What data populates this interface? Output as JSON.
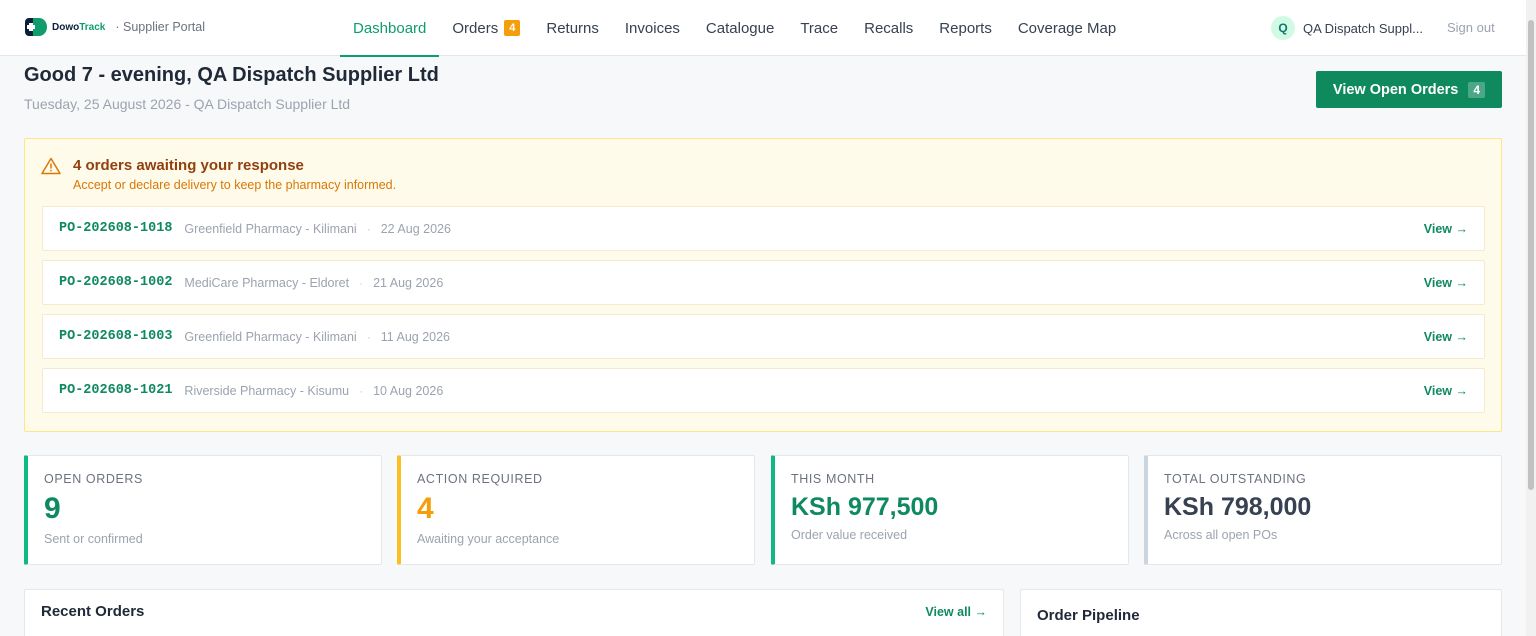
{
  "brand": {
    "name_a": "Dowo",
    "name_b": "Track",
    "portal": "· Supplier Portal"
  },
  "nav": {
    "items": [
      {
        "label": "Dashboard"
      },
      {
        "label": "Orders",
        "badge": "4"
      },
      {
        "label": "Returns"
      },
      {
        "label": "Invoices"
      },
      {
        "label": "Catalogue"
      },
      {
        "label": "Trace"
      },
      {
        "label": "Recalls"
      },
      {
        "label": "Reports"
      },
      {
        "label": "Coverage Map"
      }
    ],
    "active": "Dashboard"
  },
  "user": {
    "initial": "Q",
    "name": "QA Dispatch Suppl...",
    "signout": "Sign out"
  },
  "header": {
    "greeting": "Good 7 - evening, QA Dispatch Supplier Ltd",
    "date_line": "Tuesday, 25 August 2026 - QA Dispatch Supplier Ltd",
    "open_orders_button": "View Open Orders",
    "open_orders_count": "4"
  },
  "alert": {
    "title": "4 orders awaiting your response",
    "subtitle": "Accept or declare delivery to keep the pharmacy informed.",
    "separator": "·",
    "view_label": "View →",
    "orders": [
      {
        "po": "PO-202608-1018",
        "pharmacy": "Greenfield Pharmacy - Kilimani",
        "date": "22 Aug 2026"
      },
      {
        "po": "PO-202608-1002",
        "pharmacy": "MediCare Pharmacy - Eldoret",
        "date": "21 Aug 2026"
      },
      {
        "po": "PO-202608-1003",
        "pharmacy": "Greenfield Pharmacy - Kilimani",
        "date": "11 Aug 2026"
      },
      {
        "po": "PO-202608-1021",
        "pharmacy": "Riverside Pharmacy - Kisumu",
        "date": "10 Aug 2026"
      }
    ]
  },
  "stats": [
    {
      "label": "OPEN ORDERS",
      "value": "9",
      "sub": "Sent or confirmed",
      "color": "#0f8a5f"
    },
    {
      "label": "ACTION REQUIRED",
      "value": "4",
      "sub": "Awaiting your acceptance",
      "color": "#f59e0b"
    },
    {
      "label": "THIS MONTH",
      "value": "KSh 977,500",
      "sub": "Order value received",
      "color": "#0f8a5f"
    },
    {
      "label": "TOTAL OUTSTANDING",
      "value": "KSh 798,000",
      "sub": "Across all open POs",
      "color": "#374151"
    }
  ],
  "stat_border_colors": [
    "#10b981",
    "#fbbf24",
    "#10b981",
    "#cbd5e1"
  ],
  "panels": {
    "recent_orders": {
      "title": "Recent Orders",
      "link": "View all →"
    },
    "pipeline": {
      "title": "Order Pipeline"
    }
  }
}
